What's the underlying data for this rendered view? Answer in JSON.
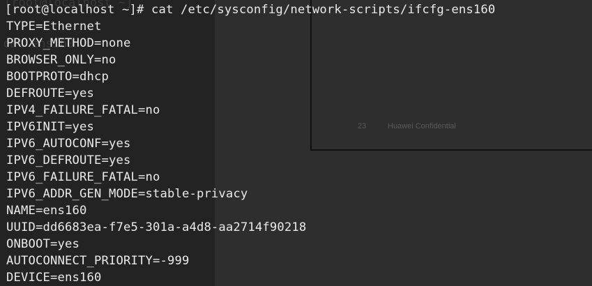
{
  "background": {
    "left_color": "#232323",
    "right_color": "#2e2e2e",
    "text_color": "#eaeaea"
  },
  "ghost": {
    "page_number": "23",
    "footer": "Huawei Confidential",
    "top_text": "[root@localhost ~]",
    "mid_text": "cat ens160"
  },
  "terminal": {
    "prompt": "[root@localhost ~]# cat /etc/sysconfig/network-scripts/ifcfg-ens160",
    "lines": [
      "TYPE=Ethernet",
      "PROXY_METHOD=none",
      "BROWSER_ONLY=no",
      "BOOTPROTO=dhcp",
      "DEFROUTE=yes",
      "IPV4_FAILURE_FATAL=no",
      "IPV6INIT=yes",
      "IPV6_AUTOCONF=yes",
      "IPV6_DEFROUTE=yes",
      "IPV6_FAILURE_FATAL=no",
      "IPV6_ADDR_GEN_MODE=stable-privacy",
      "NAME=ens160",
      "UUID=dd6683ea-f7e5-301a-a4d8-aa2714f90218",
      "ONBOOT=yes",
      "AUTOCONNECT_PRIORITY=-999",
      "DEVICE=ens160"
    ]
  }
}
